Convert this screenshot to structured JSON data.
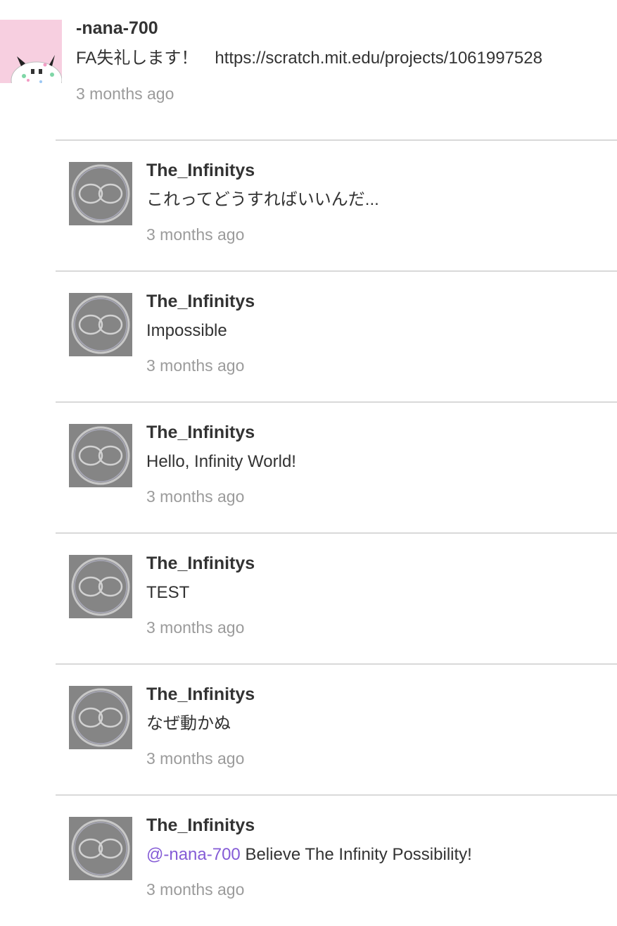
{
  "top_comment": {
    "username": "-nana-700",
    "content": "FA失礼します！　https://scratch.mit.edu/projects/1061997528",
    "time": "3 months ago"
  },
  "replies": [
    {
      "username": "The_Infinitys",
      "content": "これってどうすればいいんだ...",
      "time": "3 months ago"
    },
    {
      "username": "The_Infinitys",
      "content": "Impossible",
      "time": "3 months ago"
    },
    {
      "username": "The_Infinitys",
      "content": "Hello, Infinity World!",
      "time": "3 months ago"
    },
    {
      "username": "The_Infinitys",
      "content": "TEST",
      "time": "3 months ago"
    },
    {
      "username": "The_Infinitys",
      "content": "なぜ動かぬ",
      "time": "3 months ago"
    },
    {
      "username": "The_Infinitys",
      "mention": "@-nana-700",
      "content": " Believe The Infinity Possibility!",
      "time": "3 months ago"
    }
  ],
  "colors": {
    "text": "#333333",
    "muted": "#9b9b9b",
    "mention": "#855cd6",
    "divider": "#d9d9d9",
    "reply_avatar_bg": "#858585",
    "top_avatar_bg": "#f7cfe0"
  },
  "icons": {
    "top_avatar": "cartoon-character-avatar",
    "reply_avatar": "infinity-circle-avatar"
  }
}
